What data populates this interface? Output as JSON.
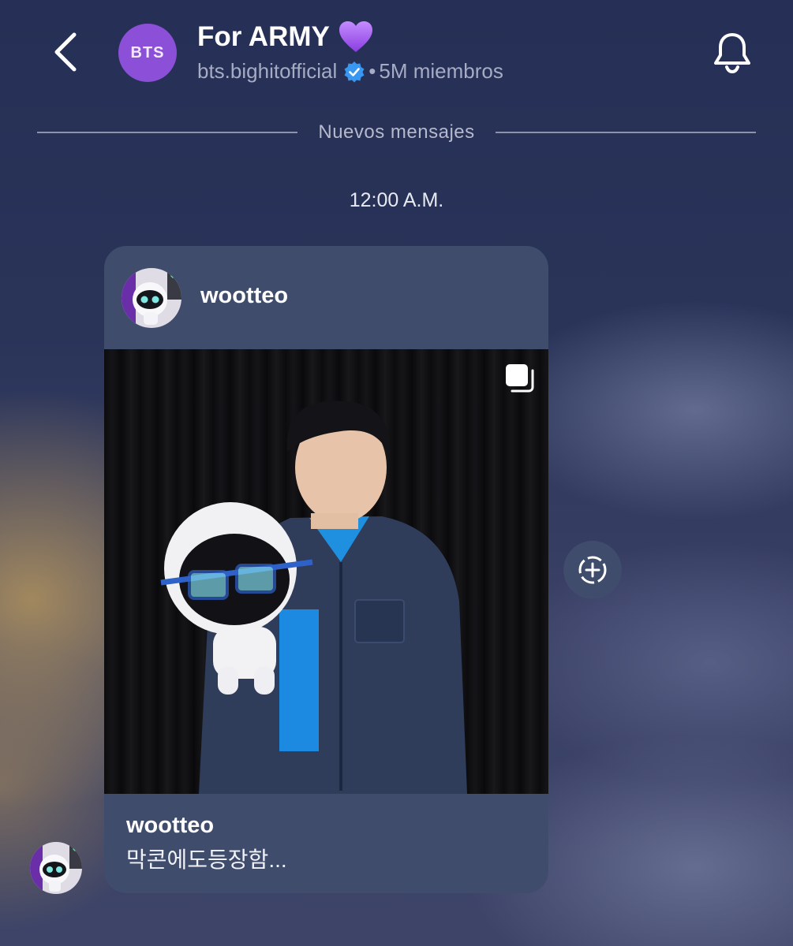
{
  "header": {
    "channel_avatar_text": "BTS",
    "title": "For ARMY",
    "title_emoji": "purple-heart",
    "account": "bts.bighitofficial",
    "separator": "•",
    "members": "5M miembros"
  },
  "divider": {
    "label": "Nuevos mensajes"
  },
  "timestamp": "12:00 A.M.",
  "post": {
    "author": "wootteo",
    "footer_author": "wootteo",
    "caption": "막콘에도등장함...",
    "is_multi_image": true
  },
  "icons": {
    "back": "chevron-left-icon",
    "verified": "verified-badge-icon",
    "notifications": "bell-icon",
    "carousel": "multiple-images-icon",
    "add": "add-circle-icon"
  },
  "colors": {
    "accent": "#3897f0",
    "avatar": "#8b4fd8",
    "card": "#3f4c6b"
  }
}
